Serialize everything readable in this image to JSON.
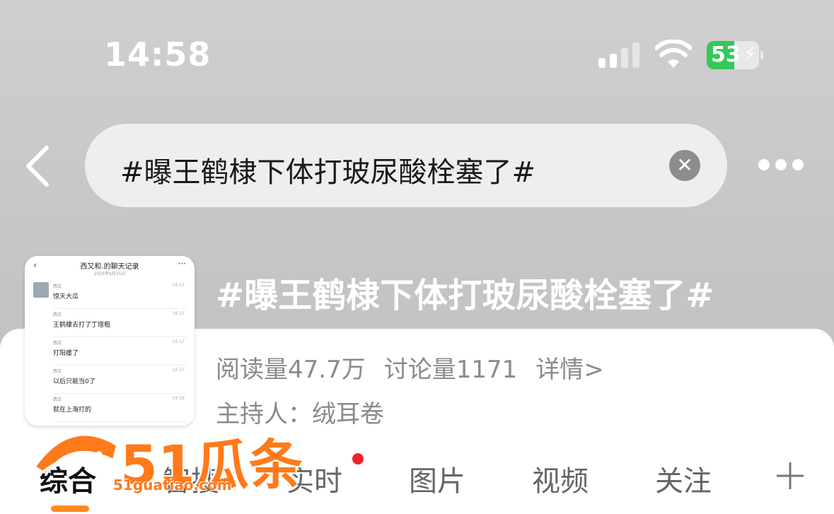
{
  "status_bar": {
    "time": "14:58",
    "battery": "53",
    "battery_level_percent": 53
  },
  "search": {
    "query": "#曝王鹤棣下体打玻尿酸栓塞了#"
  },
  "icons": {
    "back": "chevron-left-icon",
    "clear": "clear-icon",
    "more": "more-horizontal-icon",
    "plus": "plus-icon"
  },
  "topic": {
    "title": "#曝王鹤棣下体打玻尿酸栓塞了#",
    "reads": "阅读量47.7万",
    "discussions": "讨论量1171",
    "details": "详情>",
    "host": "主持人：绒耳卷"
  },
  "thumbnail": {
    "header": "西又和.的聊天记录",
    "date": "2026年9月15日",
    "messages": [
      {
        "name": "西又",
        "time": "16:17",
        "text": "惊天大瓜"
      },
      {
        "name": "西又",
        "time": "16:17",
        "text": "王鹤棣去打了丁增粗"
      },
      {
        "name": "西又",
        "time": "16:17",
        "text": "打阳痿了"
      },
      {
        "name": "西又",
        "time": "16:17",
        "text": "以后只能当0了"
      },
      {
        "name": "西又",
        "time": "16:18",
        "text": "就在上海打的"
      }
    ]
  },
  "tabs": [
    {
      "label": "综合",
      "active": true
    },
    {
      "label": "智搜"
    },
    {
      "label": "实时",
      "badge_dot": true
    },
    {
      "label": "图片"
    },
    {
      "label": "视频"
    },
    {
      "label": "关注"
    }
  ],
  "watermark": {
    "text": "51瓜条",
    "url": "51guatiao.com"
  },
  "colors": {
    "accent": "#ff8a1f",
    "badge": "#f0212b",
    "battery": "#34c759"
  }
}
